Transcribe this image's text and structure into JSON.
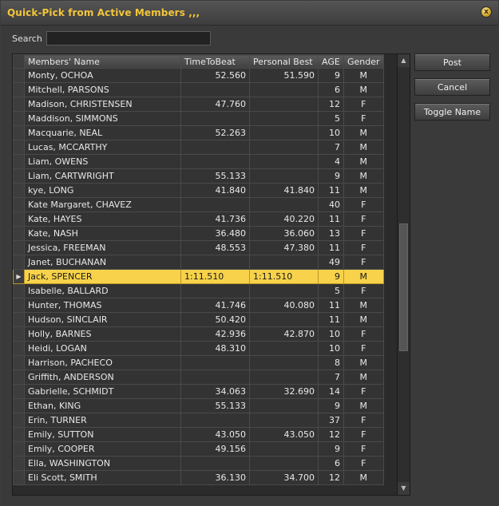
{
  "window": {
    "title": "Quick-Pick from Active Members ,,,",
    "close_glyph": "x"
  },
  "search": {
    "label": "Search",
    "value": ""
  },
  "buttons": {
    "post": "Post",
    "cancel": "Cancel",
    "toggle_name": "Toggle Name"
  },
  "columns": [
    "Members' Name",
    "TimeToBeat",
    "Personal Best",
    "AGE",
    "Gender"
  ],
  "rows": [
    {
      "name": "Monty, OCHOA",
      "ttb": "52.560",
      "pb": "51.590",
      "age": "9",
      "gender": "M"
    },
    {
      "name": "Mitchell, PARSONS",
      "ttb": "",
      "pb": "",
      "age": "6",
      "gender": "M"
    },
    {
      "name": "Madison, CHRISTENSEN",
      "ttb": "47.760",
      "pb": "",
      "age": "12",
      "gender": "F"
    },
    {
      "name": "Maddison, SIMMONS",
      "ttb": "",
      "pb": "",
      "age": "5",
      "gender": "F"
    },
    {
      "name": "Macquarie, NEAL",
      "ttb": "52.263",
      "pb": "",
      "age": "10",
      "gender": "M"
    },
    {
      "name": "Lucas, MCCARTHY",
      "ttb": "",
      "pb": "",
      "age": "7",
      "gender": "M"
    },
    {
      "name": "Liam, OWENS",
      "ttb": "",
      "pb": "",
      "age": "4",
      "gender": "M"
    },
    {
      "name": "Liam, CARTWRIGHT",
      "ttb": "55.133",
      "pb": "",
      "age": "9",
      "gender": "M"
    },
    {
      "name": "kye, LONG",
      "ttb": "41.840",
      "pb": "41.840",
      "age": "11",
      "gender": "M"
    },
    {
      "name": "Kate Margaret, CHAVEZ",
      "ttb": "",
      "pb": "",
      "age": "40",
      "gender": "F"
    },
    {
      "name": "Kate, HAYES",
      "ttb": "41.736",
      "pb": "40.220",
      "age": "11",
      "gender": "F"
    },
    {
      "name": "Kate, NASH",
      "ttb": "36.480",
      "pb": "36.060",
      "age": "13",
      "gender": "F"
    },
    {
      "name": "Jessica, FREEMAN",
      "ttb": "48.553",
      "pb": "47.380",
      "age": "11",
      "gender": "F"
    },
    {
      "name": "Janet, BUCHANAN",
      "ttb": "",
      "pb": "",
      "age": "49",
      "gender": "F"
    },
    {
      "name": "Jack, SPENCER",
      "ttb": "1:11.510",
      "pb": "1:11.510",
      "age": "9",
      "gender": "M",
      "selected": true
    },
    {
      "name": "Isabelle, BALLARD",
      "ttb": "",
      "pb": "",
      "age": "5",
      "gender": "F"
    },
    {
      "name": "Hunter, THOMAS",
      "ttb": "41.746",
      "pb": "40.080",
      "age": "11",
      "gender": "M"
    },
    {
      "name": "Hudson, SINCLAIR",
      "ttb": "50.420",
      "pb": "",
      "age": "11",
      "gender": "M"
    },
    {
      "name": "Holly, BARNES",
      "ttb": "42.936",
      "pb": "42.870",
      "age": "10",
      "gender": "F"
    },
    {
      "name": "Heidi, LOGAN",
      "ttb": "48.310",
      "pb": "",
      "age": "10",
      "gender": "F"
    },
    {
      "name": "Harrison, PACHECO",
      "ttb": "",
      "pb": "",
      "age": "8",
      "gender": "M"
    },
    {
      "name": "Griffith, ANDERSON",
      "ttb": "",
      "pb": "",
      "age": "7",
      "gender": "M"
    },
    {
      "name": "Gabrielle, SCHMIDT",
      "ttb": "34.063",
      "pb": "32.690",
      "age": "14",
      "gender": "F"
    },
    {
      "name": "Ethan, KING",
      "ttb": "55.133",
      "pb": "",
      "age": "9",
      "gender": "M"
    },
    {
      "name": "Erin, TURNER",
      "ttb": "",
      "pb": "",
      "age": "37",
      "gender": "F"
    },
    {
      "name": "Emily, SUTTON",
      "ttb": "43.050",
      "pb": "43.050",
      "age": "12",
      "gender": "F"
    },
    {
      "name": "Emily, COOPER",
      "ttb": "49.156",
      "pb": "",
      "age": "9",
      "gender": "F"
    },
    {
      "name": "Ella, WASHINGTON",
      "ttb": "",
      "pb": "",
      "age": "6",
      "gender": "F"
    },
    {
      "name": "Eli Scott, SMITH",
      "ttb": "36.130",
      "pb": "34.700",
      "age": "12",
      "gender": "M"
    }
  ],
  "colors": {
    "title": "#f2c53a",
    "selected_row": "#f7d24a"
  },
  "icons": {
    "row_indicator": "triangle-right-icon",
    "scroll_up": "chevron-up-icon",
    "scroll_down": "chevron-down-icon",
    "close": "close-icon"
  }
}
